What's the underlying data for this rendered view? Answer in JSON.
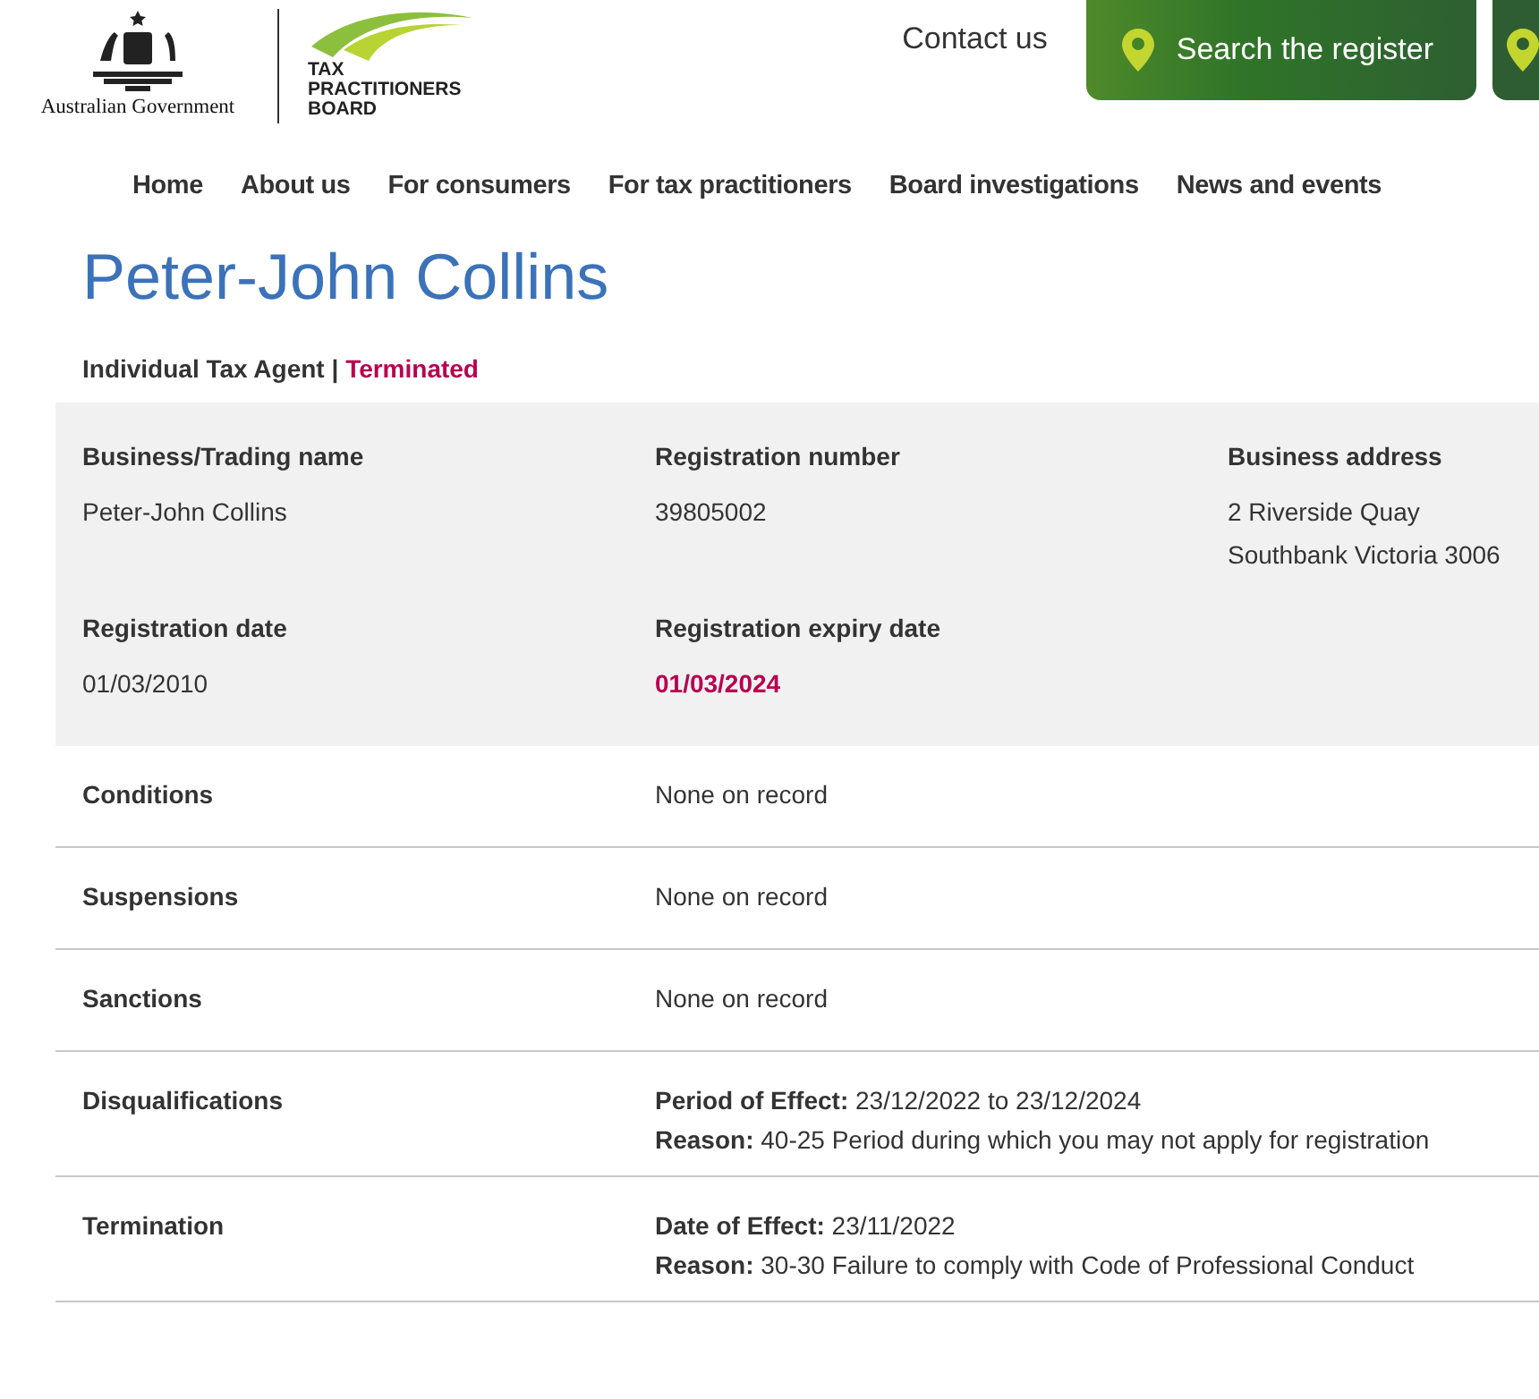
{
  "header": {
    "government": "Australian Government",
    "board": [
      "TAX",
      "PRACTITIONERS",
      "BOARD"
    ],
    "contact": "Contact us",
    "search_button": "Search the register"
  },
  "nav": [
    "Home",
    "About us",
    "For consumers",
    "For tax practitioners",
    "Board investigations",
    "News and events"
  ],
  "title": "Peter-John Collins",
  "subtitle": {
    "type": "Individual Tax Agent",
    "separator": "|",
    "status": "Terminated"
  },
  "details": [
    {
      "label": "Business/Trading name",
      "kind": "plain",
      "lines": [
        "Peter-John Collins"
      ]
    },
    {
      "label": "Registration number",
      "kind": "plain",
      "lines": [
        "39805002"
      ]
    },
    {
      "label": "Business address",
      "kind": "plain",
      "lines": [
        "2 Riverside Quay",
        "Southbank Victoria 3006"
      ]
    },
    {
      "label": "Registration date",
      "kind": "plain",
      "lines": [
        "01/03/2010"
      ]
    },
    {
      "label": "Registration expiry date",
      "kind": "alert",
      "lines": [
        "01/03/2024"
      ]
    }
  ],
  "records": [
    {
      "label": "Conditions",
      "kind": "text",
      "value": "None on record"
    },
    {
      "label": "Suspensions",
      "kind": "text",
      "value": "None on record"
    },
    {
      "label": "Sanctions",
      "kind": "text",
      "value": "None on record"
    },
    {
      "label": "Disqualifications",
      "kind": "fields",
      "fields": [
        {
          "name": "Period of Effect:",
          "value": "23/12/2022 to 23/12/2024"
        },
        {
          "name": "Reason:",
          "value": "40-25 Period during which you may not apply for registration"
        }
      ]
    },
    {
      "label": "Termination",
      "kind": "fields",
      "fields": [
        {
          "name": "Date of Effect:",
          "value": "23/11/2022"
        },
        {
          "name": "Reason:",
          "value": "30-30 Failure to comply with Code of Professional Conduct"
        }
      ]
    }
  ]
}
